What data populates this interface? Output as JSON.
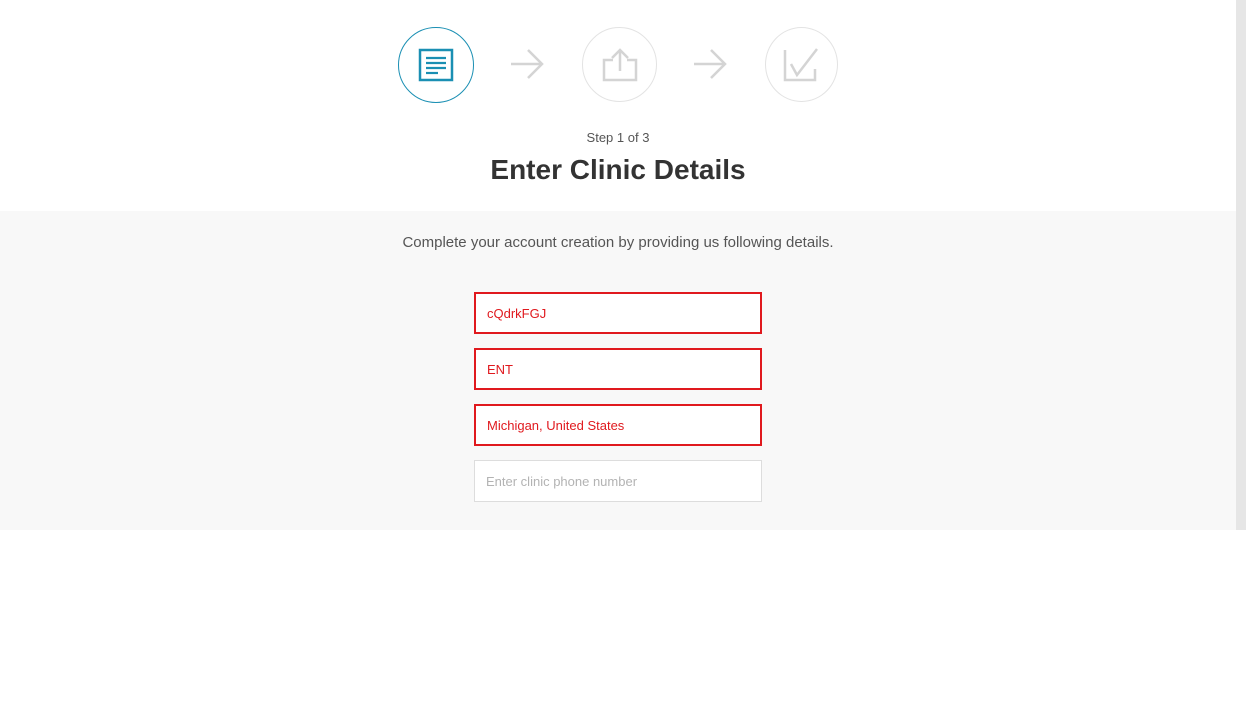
{
  "stepper": {
    "steps": [
      {
        "icon": "document-icon",
        "state": "active"
      },
      {
        "icon": "upload-icon",
        "state": "inactive"
      },
      {
        "icon": "checkmark-icon",
        "state": "inactive"
      }
    ],
    "accent_color": "#1a8fb3",
    "inactive_color": "#d9d9d9"
  },
  "header": {
    "step_text": "Step 1 of 3",
    "title": "Enter Clinic Details"
  },
  "form": {
    "subtitle": "Complete your account creation by providing us following details.",
    "error_color": "#e0191e",
    "fields": [
      {
        "value": "cQdrkFGJ",
        "placeholder": "",
        "state": "error"
      },
      {
        "value": "ENT",
        "placeholder": "",
        "state": "error"
      },
      {
        "value": "Michigan, United States",
        "placeholder": "",
        "state": "error"
      },
      {
        "value": "",
        "placeholder": "Enter clinic phone number",
        "state": "normal"
      }
    ]
  }
}
